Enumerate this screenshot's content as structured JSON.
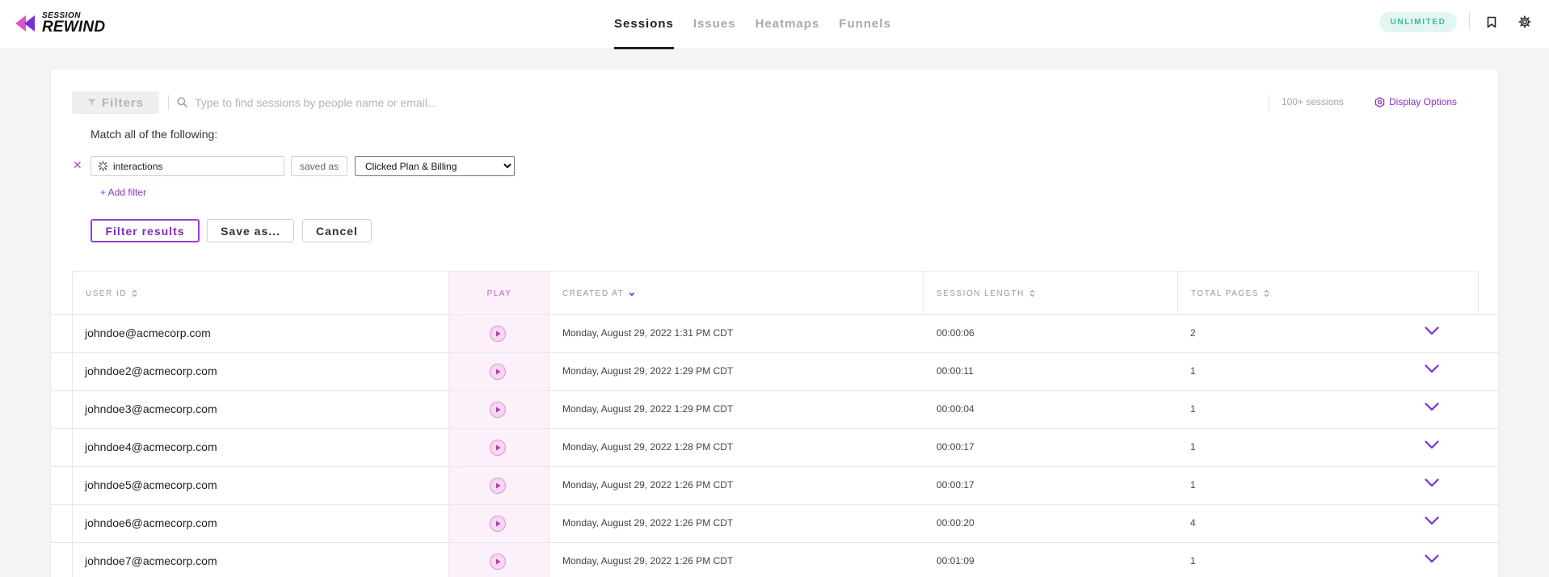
{
  "app": {
    "logo_line1": "SESSION",
    "logo_line2": "REWIND"
  },
  "nav": {
    "tabs": [
      {
        "label": "Sessions",
        "active": true
      },
      {
        "label": "Issues",
        "active": false
      },
      {
        "label": "Heatmaps",
        "active": false
      },
      {
        "label": "Funnels",
        "active": false
      }
    ]
  },
  "header": {
    "plan_badge": "UNLIMITED",
    "icons": [
      "bookmark-icon",
      "gear-icon"
    ]
  },
  "filter_bar": {
    "filters_label": "Filters",
    "search_placeholder": "Type to find sessions by people name or email...",
    "session_count": "100+ sessions",
    "display_options_label": "Display Options"
  },
  "filter_builder": {
    "match_label": "Match all of the following:",
    "conditions": [
      {
        "field": "interactions",
        "operator": "saved as",
        "value": "Clicked Plan & Billing"
      }
    ],
    "add_filter_label": "+ Add filter",
    "buttons": {
      "filter": "Filter results",
      "save": "Save as...",
      "cancel": "Cancel"
    }
  },
  "table": {
    "columns": {
      "user_id": "USER ID",
      "play": "PLAY",
      "created_at": "CREATED AT",
      "session_length": "SESSION LENGTH",
      "total_pages": "TOTAL PAGES"
    },
    "rows": [
      {
        "user_id": "johndoe@acmecorp.com",
        "created_at": "Monday, August 29, 2022 1:31 PM CDT",
        "session_length": "00:00:06",
        "total_pages": "2"
      },
      {
        "user_id": "johndoe2@acmecorp.com",
        "created_at": "Monday, August 29, 2022 1:29 PM CDT",
        "session_length": "00:00:11",
        "total_pages": "1"
      },
      {
        "user_id": "johndoe3@acmecorp.com",
        "created_at": "Monday, August 29, 2022 1:29 PM CDT",
        "session_length": "00:00:04",
        "total_pages": "1"
      },
      {
        "user_id": "johndoe4@acmecorp.com",
        "created_at": "Monday, August 29, 2022 1:28 PM CDT",
        "session_length": "00:00:17",
        "total_pages": "1"
      },
      {
        "user_id": "johndoe5@acmecorp.com",
        "created_at": "Monday, August 29, 2022 1:26 PM CDT",
        "session_length": "00:00:17",
        "total_pages": "1"
      },
      {
        "user_id": "johndoe6@acmecorp.com",
        "created_at": "Monday, August 29, 2022 1:26 PM CDT",
        "session_length": "00:00:20",
        "total_pages": "4"
      },
      {
        "user_id": "johndoe7@acmecorp.com",
        "created_at": "Monday, August 29, 2022 1:26 PM CDT",
        "session_length": "00:01:09",
        "total_pages": "1"
      }
    ]
  },
  "colors": {
    "accent_purple": "#8a32c8",
    "badge_teal": "#3fb8a0",
    "play_pink": "#f6d6f0"
  }
}
